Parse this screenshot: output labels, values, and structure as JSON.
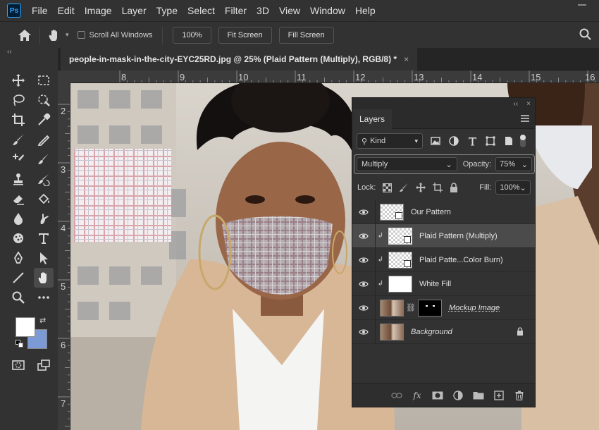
{
  "app": {
    "logo": "Ps"
  },
  "menu": [
    "File",
    "Edit",
    "Image",
    "Layer",
    "Type",
    "Select",
    "Filter",
    "3D",
    "View",
    "Window",
    "Help"
  ],
  "options": {
    "scroll_all_windows": "Scroll All Windows",
    "zoom_btn": "100%",
    "fit_btn": "Fit Screen",
    "fill_btn": "Fill Screen"
  },
  "document": {
    "tab_title": "people-in-mask-in-the-city-EYC25RD.jpg @ 25% (Plaid Pattern (Multiply), RGB/8) *",
    "close": "×"
  },
  "toolbar_collapse": "‹‹",
  "rulers": {
    "top": [
      "8",
      "9",
      "10",
      "11",
      "12",
      "13",
      "14",
      "15",
      "16"
    ],
    "left": [
      "2",
      "3",
      "4",
      "5",
      "6",
      "7"
    ]
  },
  "layers_panel": {
    "collapse": "‹‹",
    "close": "×",
    "tab": "Layers",
    "filter_kind": "Kind",
    "blend_mode": "Multiply",
    "opacity_label": "Opacity:",
    "opacity_value": "75%",
    "lock_label": "Lock:",
    "fill_label": "Fill:",
    "fill_value": "100%",
    "layers": [
      {
        "name": "Our Pattern",
        "clipped": false,
        "selected": false
      },
      {
        "name": "Plaid Pattern (Multiply)",
        "clipped": true,
        "selected": true
      },
      {
        "name": "Plaid Patte...Color Burn)",
        "clipped": true,
        "selected": false
      },
      {
        "name": "White Fill",
        "clipped": true,
        "selected": false
      },
      {
        "name": "Mockup Image",
        "clipped": false,
        "selected": false
      },
      {
        "name": "Background",
        "clipped": false,
        "selected": false
      }
    ]
  },
  "colors": {
    "foreground": "#ffffff",
    "background": "#7b9ad6",
    "panel": "#323232",
    "selected_layer": "#4b4b4b"
  }
}
